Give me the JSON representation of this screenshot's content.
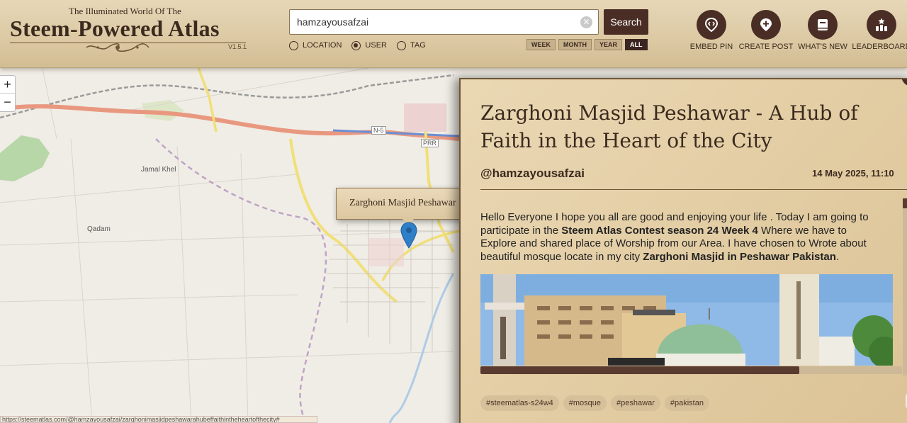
{
  "header": {
    "kicker": "The Illuminated World Of The",
    "title": "Steem-Powered Atlas",
    "version": "V1.5.1",
    "search": {
      "value": "hamzayousafzai",
      "button_label": "Search"
    },
    "search_modes": [
      {
        "label": "LOCATION",
        "selected": false
      },
      {
        "label": "USER",
        "selected": true
      },
      {
        "label": "TAG",
        "selected": false
      }
    ],
    "periods": [
      {
        "label": "WEEK",
        "active": false
      },
      {
        "label": "MONTH",
        "active": false
      },
      {
        "label": "YEAR",
        "active": false
      },
      {
        "label": "ALL",
        "active": true
      }
    ],
    "nav": [
      {
        "label": "EMBED PIN",
        "icon": "embed-pin-icon"
      },
      {
        "label": "CREATE POST",
        "icon": "plus-icon"
      },
      {
        "label": "WHAT'S NEW",
        "icon": "book-icon"
      },
      {
        "label": "LEADERBOARD",
        "icon": "leaderboard-icon"
      }
    ]
  },
  "map": {
    "zoom_in": "+",
    "zoom_out": "−",
    "places": [
      "Jamal Khel",
      "Qadam",
      "PRR",
      "N-5"
    ],
    "popup_label": "Zarghoni Masjid Peshawar",
    "status_url": "https://steematlas.com/@hamzayousafzai/zarghonimasjidpeshawarahubeffaithintheheartofthecity#"
  },
  "post": {
    "title": "Zarghoni Masjid Peshawar - A Hub of Faith in the Heart of the City",
    "author": "@hamzayousafzai",
    "date": "14 May 2025, 11:10",
    "body": {
      "p1": "Hello Everyone I hope you all are good and enjoying your life . Today I am going to participate in the ",
      "b1": "Steem Atlas Contest season 24 Week 4",
      "p2": " Where we have to Explore and shared place of Worship from our Area. I have chosen to Wrote about beautiful mosque locate in my city ",
      "b2": "Zarghoni Masjid in Peshawar Pakistan",
      "p3": "."
    },
    "tags": [
      "#steematlas-s24w4",
      "#mosque",
      "#peshawar",
      "#pakistan"
    ]
  },
  "colors": {
    "brand_dark": "#4a2e26",
    "parchment": "#e3cda4",
    "ink": "#3b2a1e"
  }
}
